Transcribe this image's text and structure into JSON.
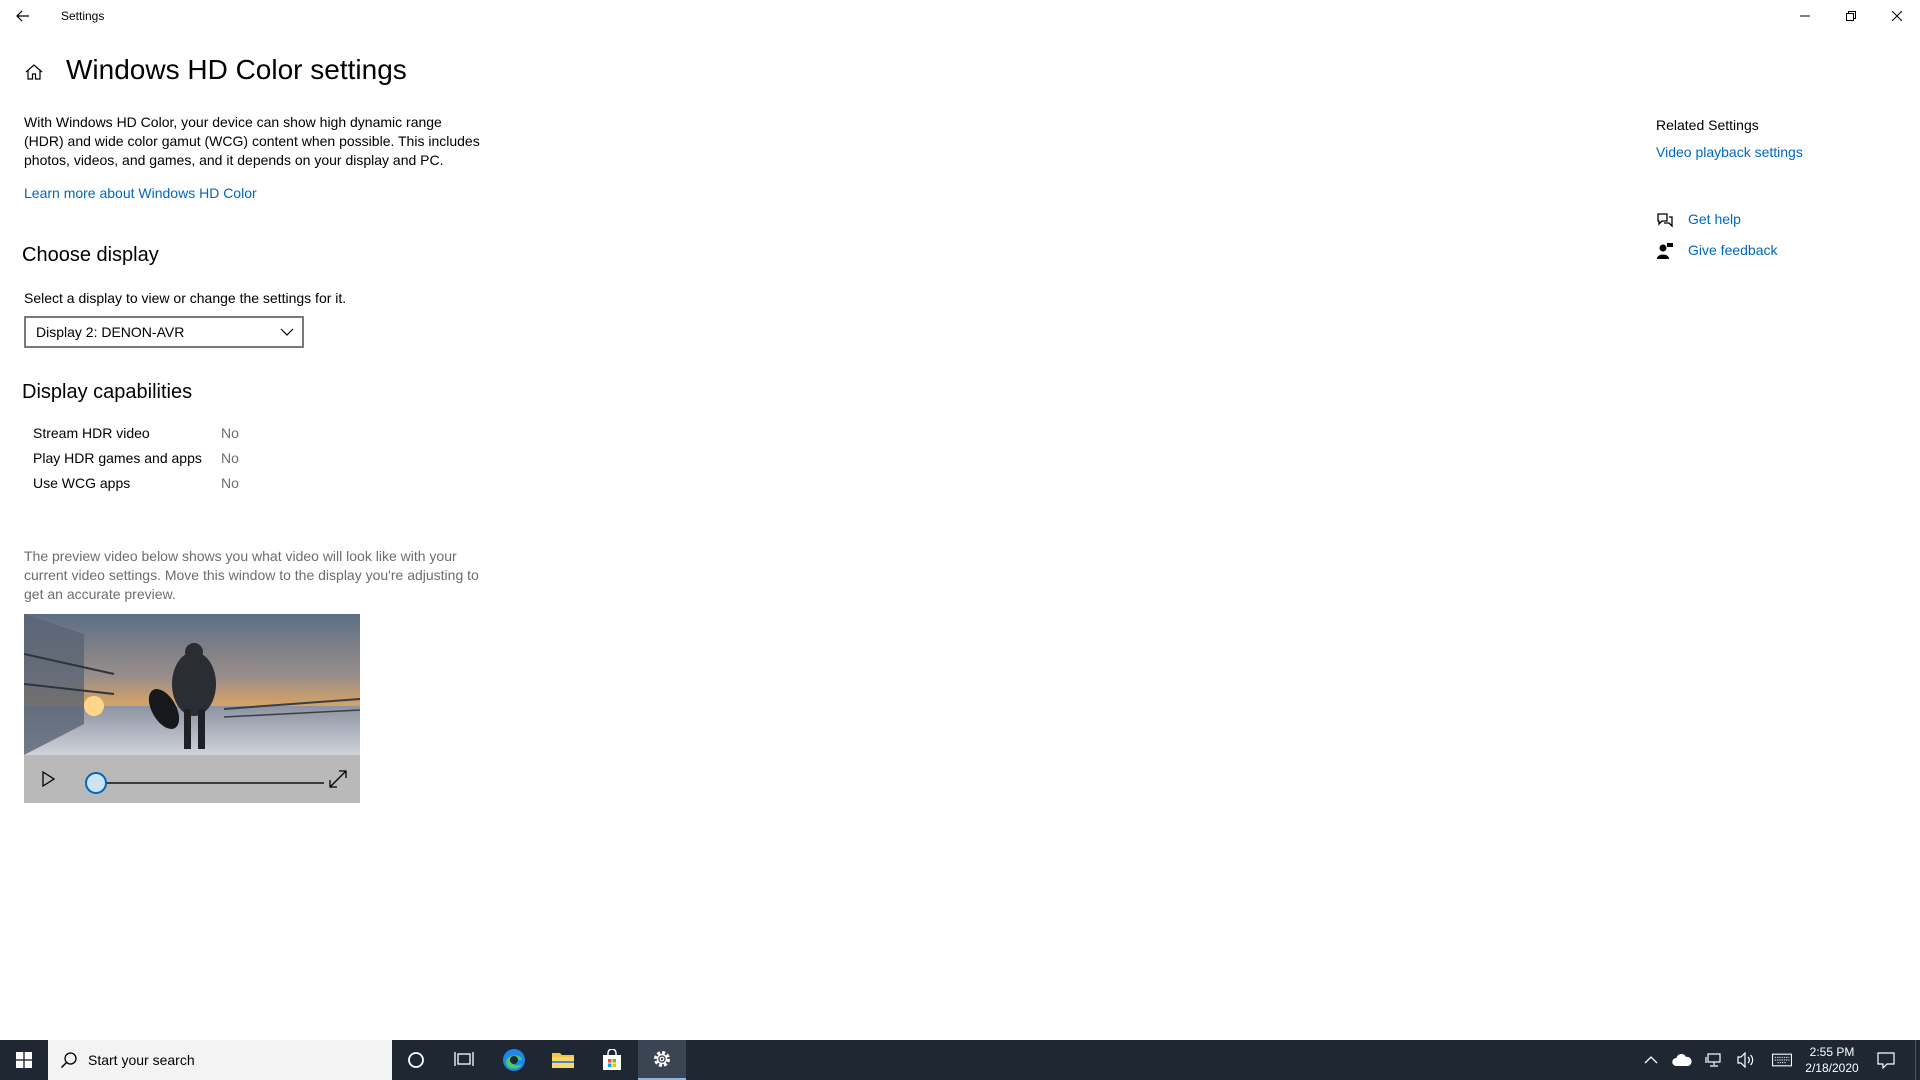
{
  "window": {
    "title": "Settings",
    "page_title": "Windows HD Color settings"
  },
  "intro": {
    "text": "With Windows HD Color, your device can show high dynamic range (HDR) and wide color gamut (WCG) content when possible. This includes photos, videos, and games, and it depends on your display and PC.",
    "learn_more": "Learn more about Windows HD Color"
  },
  "choose_display": {
    "heading": "Choose display",
    "label": "Select a display to view or change the settings for it.",
    "selected": "Display 2: DENON-AVR"
  },
  "capabilities": {
    "heading": "Display capabilities",
    "rows": [
      {
        "name": "Stream HDR video",
        "value": "No"
      },
      {
        "name": "Play HDR games and apps",
        "value": "No"
      },
      {
        "name": "Use WCG apps",
        "value": "No"
      }
    ]
  },
  "preview": {
    "text": "The preview video below shows you what video will look like with your current video settings. Move this window to the display you're adjusting to get an accurate preview.",
    "progress": 0
  },
  "related": {
    "title": "Related Settings",
    "video_playback": "Video playback settings",
    "get_help": "Get help",
    "give_feedback": "Give feedback"
  },
  "taskbar": {
    "search_placeholder": "Start your search",
    "time": "2:55 PM",
    "date": "2/18/2020"
  },
  "colors": {
    "link": "#0067c0",
    "taskbar": "#1f2733",
    "accent": "#0067c0"
  }
}
